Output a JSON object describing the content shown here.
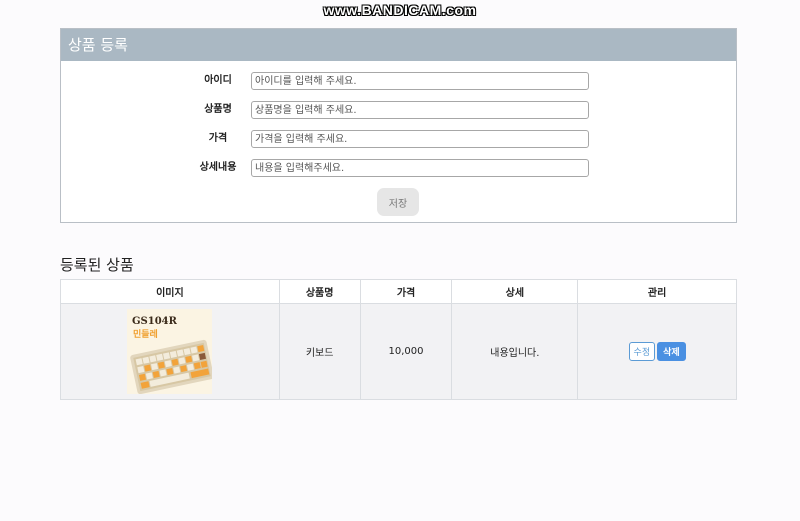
{
  "watermark": "www.BANDICAM.com",
  "form": {
    "title": "상품 등록",
    "fields": [
      {
        "label": "아이디",
        "placeholder": "아이디를 입력해 주세요."
      },
      {
        "label": "상품명",
        "placeholder": "상품명을 입력해 주세요."
      },
      {
        "label": "가격",
        "placeholder": "가격을 입력해 주세요."
      },
      {
        "label": "상세내용",
        "placeholder": "내용을 입력해주세요."
      }
    ],
    "save_label": "저장"
  },
  "list": {
    "title": "등록된 상품",
    "columns": [
      "이미지",
      "상품명",
      "가격",
      "상세",
      "관리"
    ],
    "rows": [
      {
        "image_title": "GS104R",
        "image_subtitle": "민들레",
        "name": "키보드",
        "price": "10,000",
        "detail": "내용입니다.",
        "edit_label": "수정",
        "delete_label": "삭제"
      }
    ]
  }
}
